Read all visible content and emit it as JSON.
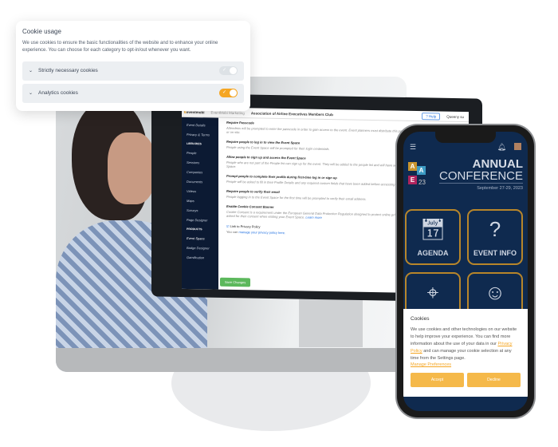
{
  "cookie_card": {
    "title": "Cookie usage",
    "description": "We use cookies to ensure the basic functionalities of the website and to enhance your online experience. You can choose for each category to opt-in/out whenever you want.",
    "categories": [
      {
        "label": "Strictly necessary cookies",
        "enabled": true,
        "locked": true
      },
      {
        "label": "Analytics cookies",
        "enabled": true,
        "locked": false
      }
    ],
    "accent": "#f5a623"
  },
  "desktop": {
    "logo": "eventmobi",
    "org_menu": "EventMobi Marketing",
    "event_name": "Association of Airline Executives Members Club",
    "help": "Help",
    "user": "Queeny su",
    "sidebar": {
      "items": [
        "Event Details",
        "Privacy & Terms"
      ],
      "libraries_heading": "LIBRARIES",
      "libraries": [
        "People",
        "Sessions",
        "Companies",
        "Documents",
        "Videos",
        "Maps",
        "Surveys",
        "Page Designer"
      ],
      "products_heading": "PRODUCTS",
      "products": [
        "Event Space",
        "Badge Designer",
        "Gamification"
      ]
    },
    "settings": [
      {
        "title": "Require Passcode",
        "desc": "Attendees will be prompted to enter the passcode in order to gain access to the event. Event planners must distribute this passcode pre-event or on site.",
        "on": false
      },
      {
        "title": "Require people to log in to view the Event Space",
        "desc": "People using the Event Space will be prompted for their login credentials.",
        "on": false
      },
      {
        "title": "Allow people to sign up and access the Event Space",
        "desc": "People who are not part of the People list can sign up for the event. They will be added to the people list and will have access to the Event Space.",
        "on": true
      },
      {
        "title": "Prompt people to complete their profile during first-time log in or sign up",
        "desc": "People will be asked to fill in their Profile Details and any required custom fields that have been added before accessing the Event Space.",
        "on": false
      },
      {
        "title": "Require people to verify their email",
        "desc": "People logging in to the Event Space for the first time will be prompted to verify their email address.",
        "on": true
      },
      {
        "title": "Enable Cookie Consent Banner",
        "desc": "Cookie Consent is a requirement under the European General Data Protection Regulation designed to protect online privacy. Visitors will be asked for their consent when visiting your Event Space.",
        "on": true
      }
    ],
    "learn_more": "Learn more",
    "privacy_checkbox": "Link to Privacy Policy",
    "privacy_prefix": "You can",
    "privacy_link": "manage your privacy policy here.",
    "save": "Save Changes"
  },
  "phone": {
    "logo_letters": [
      "A",
      "A",
      "E",
      "23"
    ],
    "title1": "ANNUAL",
    "title2": "CONFERENCE",
    "date": "September 27-29, 2023",
    "tiles": [
      "AGENDA",
      "EVENT INFO",
      "",
      ""
    ],
    "cookies": {
      "title": "Cookies",
      "text1": "We use cookies and other technologies on our website to help improve your experience. You can find more information about the use of your data in our",
      "privacy": "Privacy Policy",
      "text2": "and can manage your cookie selection at any time from the Settings page.",
      "manage": "Manage Preferences",
      "accept": "Accept",
      "decline": "Decline"
    }
  }
}
